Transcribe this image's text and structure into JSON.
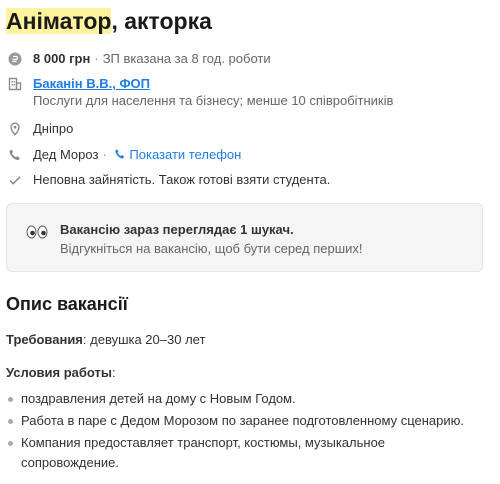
{
  "vacancy": {
    "title_highlight": "Аніматор",
    "title_rest": ", акторка",
    "salary": {
      "amount": "8 000 грн",
      "separator": "·",
      "note": "ЗП вказана за 8 год. роботи",
      "icon": "currency-icon"
    },
    "company": {
      "name": "Баканін В.В., ФОП",
      "description": "Послуги для населення та бізнесу; менше 10 співробітників",
      "icon": "building-icon"
    },
    "location": {
      "city": "Дніпро",
      "icon": "location-pin-icon"
    },
    "contact": {
      "name": "Дед Мороз",
      "separator": "·",
      "show_phone_label": "Показати телефон",
      "icon": "phone-icon"
    },
    "employment": {
      "text": "Неповна зайнятість. Також готові взяти студента.",
      "icon": "checkmark-icon"
    }
  },
  "notice": {
    "icon": "eyes-emoji",
    "line1": "Вакансію зараз переглядає 1 шукач.",
    "line2": "Відгукніться на вакансію, щоб бути серед перших!"
  },
  "description": {
    "heading": "Опис вакансії",
    "requirements_label": "Требования",
    "requirements_value": ": девушка 20–30 лет",
    "conditions_label": "Условия работы",
    "conditions_colon": ":",
    "conditions": [
      "поздравления детей на дому с Новым Годом.",
      "Работа в паре с Дедом Морозом по заранее подготовленному сценарию.",
      "Компания предоставляет транспорт, костюмы, музыкальное сопровождение."
    ]
  },
  "colors": {
    "link": "#1f7de6",
    "title_highlight": "#fff3a0",
    "notice_bg": "#f5f5f5"
  }
}
